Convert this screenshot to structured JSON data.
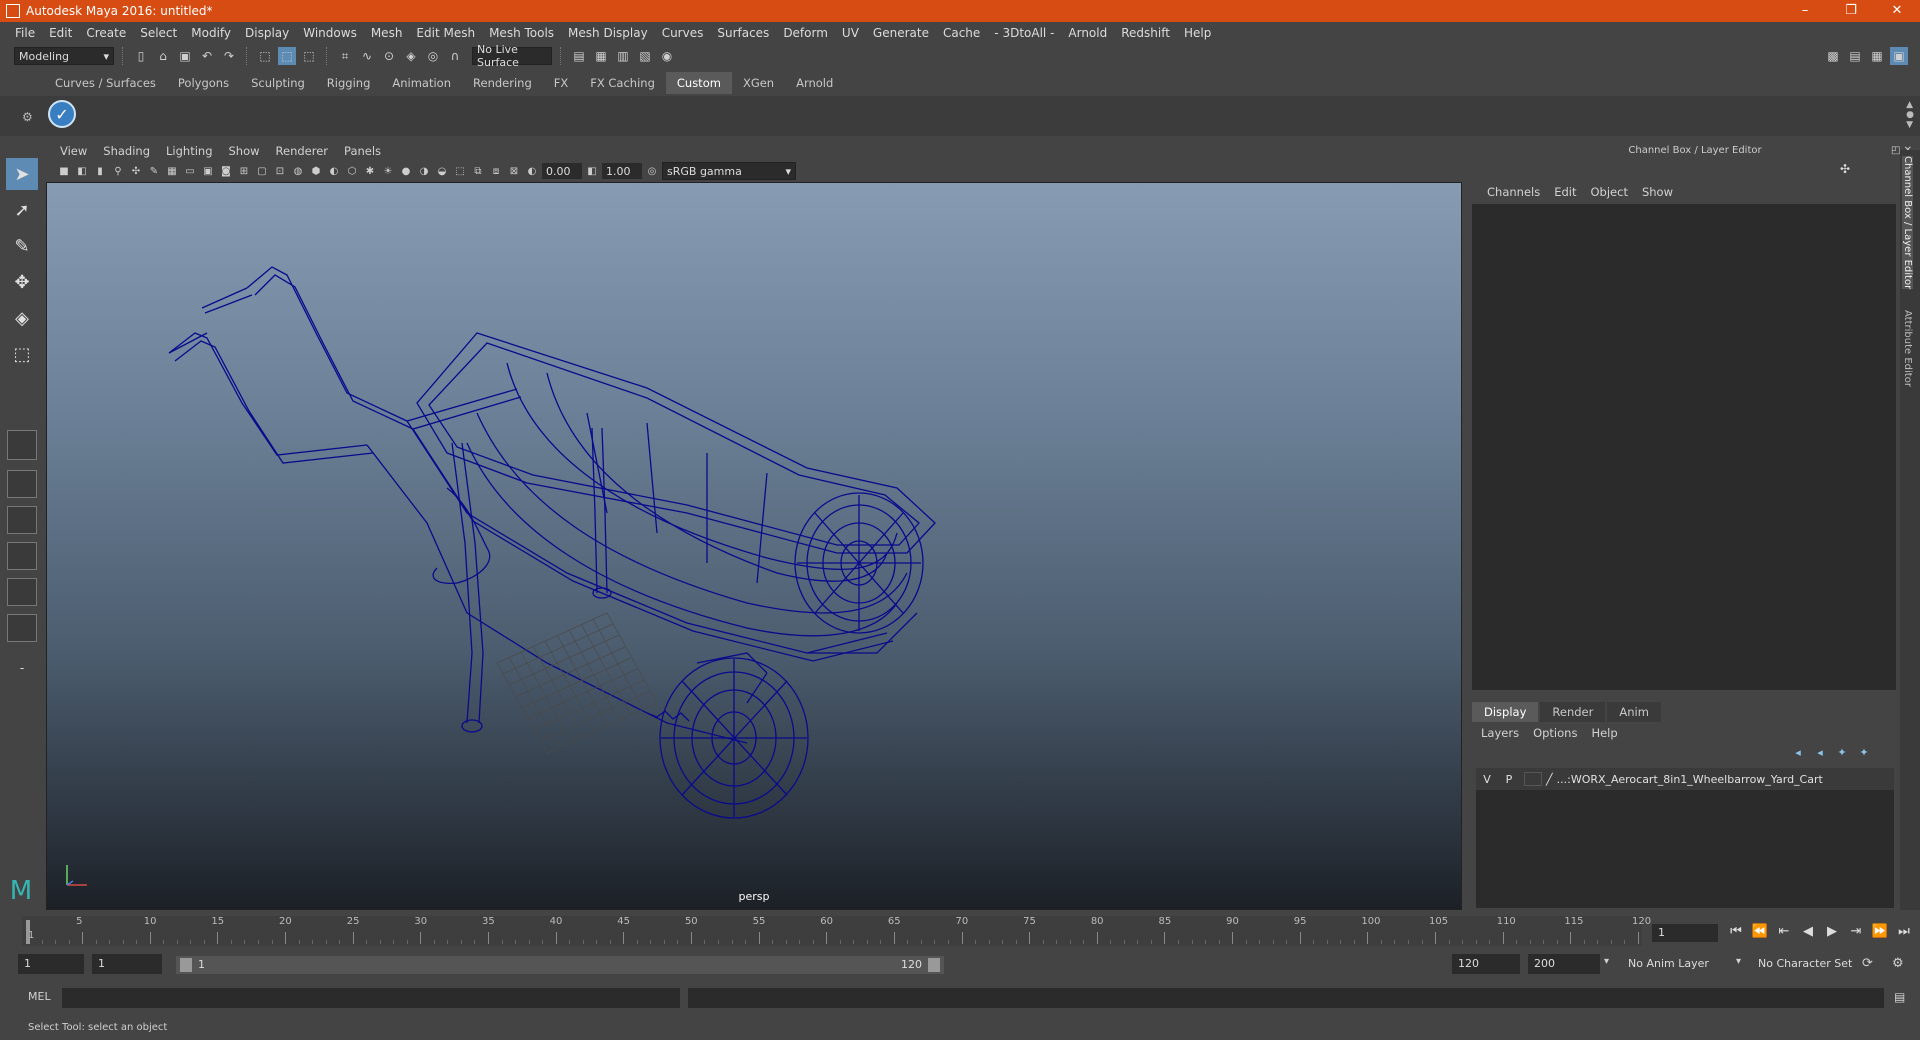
{
  "window": {
    "title": "Autodesk Maya 2016: untitled*",
    "controls": {
      "minimize": "–",
      "maximize": "❐",
      "close": "✕"
    }
  },
  "menubar": [
    "File",
    "Edit",
    "Create",
    "Select",
    "Modify",
    "Display",
    "Windows",
    "Mesh",
    "Edit Mesh",
    "Mesh Tools",
    "Mesh Display",
    "Curves",
    "Surfaces",
    "Deform",
    "UV",
    "Generate",
    "Cache",
    "- 3DtoAll -",
    "Arnold",
    "Redshift",
    "Help"
  ],
  "statusline": {
    "menuset": "Modeling",
    "live_surface": "No Live Surface"
  },
  "shelf": {
    "tabs": [
      "Curves / Surfaces",
      "Polygons",
      "Sculpting",
      "Rigging",
      "Animation",
      "Rendering",
      "FX",
      "FX Caching",
      "Custom",
      "XGen",
      "Arnold"
    ],
    "active_tab": "Custom"
  },
  "viewport": {
    "menu": [
      "View",
      "Shading",
      "Lighting",
      "Show",
      "Renderer",
      "Panels"
    ],
    "exposure": "0.00",
    "gamma": "1.00",
    "color_space": "sRGB gamma",
    "camera": "persp",
    "wire_color": "#0a0a8c"
  },
  "channel_box": {
    "title": "Channel Box / Layer Editor",
    "menu": [
      "Channels",
      "Edit",
      "Object",
      "Show"
    ]
  },
  "layer_editor": {
    "tabs": [
      "Display",
      "Render",
      "Anim"
    ],
    "active_tab": "Display",
    "menu": [
      "Layers",
      "Options",
      "Help"
    ],
    "layers": [
      {
        "v": "V",
        "p": "P",
        "name": "...:WORX_Aerocart_8in1_Wheelbarrow_Yard_Cart"
      }
    ]
  },
  "side_tabs": [
    "Channel Box / Layer Editor",
    "Attribute Editor"
  ],
  "timeline": {
    "start_label": "1",
    "ticks": [
      "5",
      "10",
      "15",
      "20",
      "25",
      "30",
      "35",
      "40",
      "45",
      "50",
      "55",
      "60",
      "65",
      "70",
      "75",
      "80",
      "85",
      "90",
      "95",
      "100",
      "105",
      "110",
      "115",
      "120"
    ],
    "current_frame": "1"
  },
  "range": {
    "start": "1",
    "playback_start": "1",
    "slider_start": "1",
    "slider_end": "120",
    "playback_end": "120",
    "end": "200",
    "anim_layer": "No Anim Layer",
    "character_set": "No Character Set"
  },
  "command_line": {
    "label": "MEL"
  },
  "help_line": "Select Tool: select an object"
}
